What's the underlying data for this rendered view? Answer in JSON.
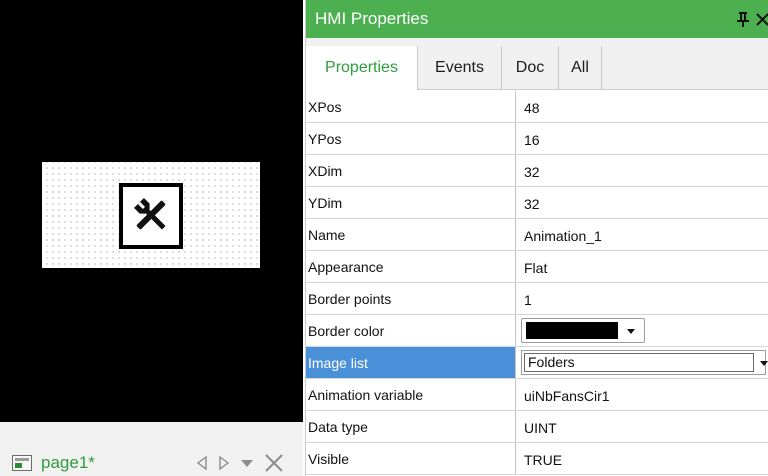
{
  "panel": {
    "title": "HMI Properties",
    "tabs": [
      {
        "label": "Properties",
        "active": true
      },
      {
        "label": "Events",
        "active": false
      },
      {
        "label": "Doc",
        "active": false
      },
      {
        "label": "All",
        "active": false
      }
    ],
    "properties": [
      {
        "name": "XPos",
        "value": "48"
      },
      {
        "name": "YPos",
        "value": "16"
      },
      {
        "name": "XDim",
        "value": "32"
      },
      {
        "name": "YDim",
        "value": "32"
      },
      {
        "name": "Name",
        "value": "Animation_1"
      },
      {
        "name": "Appearance",
        "value": "Flat"
      },
      {
        "name": "Border points",
        "value": "1"
      },
      {
        "name": "Border color",
        "value": "#000000"
      },
      {
        "name": "Image list",
        "value": "Folders"
      },
      {
        "name": "Animation variable",
        "value": "uiNbFansCir1"
      },
      {
        "name": "Data type",
        "value": "UINT"
      },
      {
        "name": "Visible",
        "value": "TRUE"
      }
    ]
  },
  "editor": {
    "page_tab_label": "page1*",
    "widget_icon": "tools-icon"
  },
  "colors": {
    "accent": "#4caf50",
    "accent_text": "#2e9c3d",
    "selection": "#4a90d9",
    "canvas_bg": "#000000"
  }
}
